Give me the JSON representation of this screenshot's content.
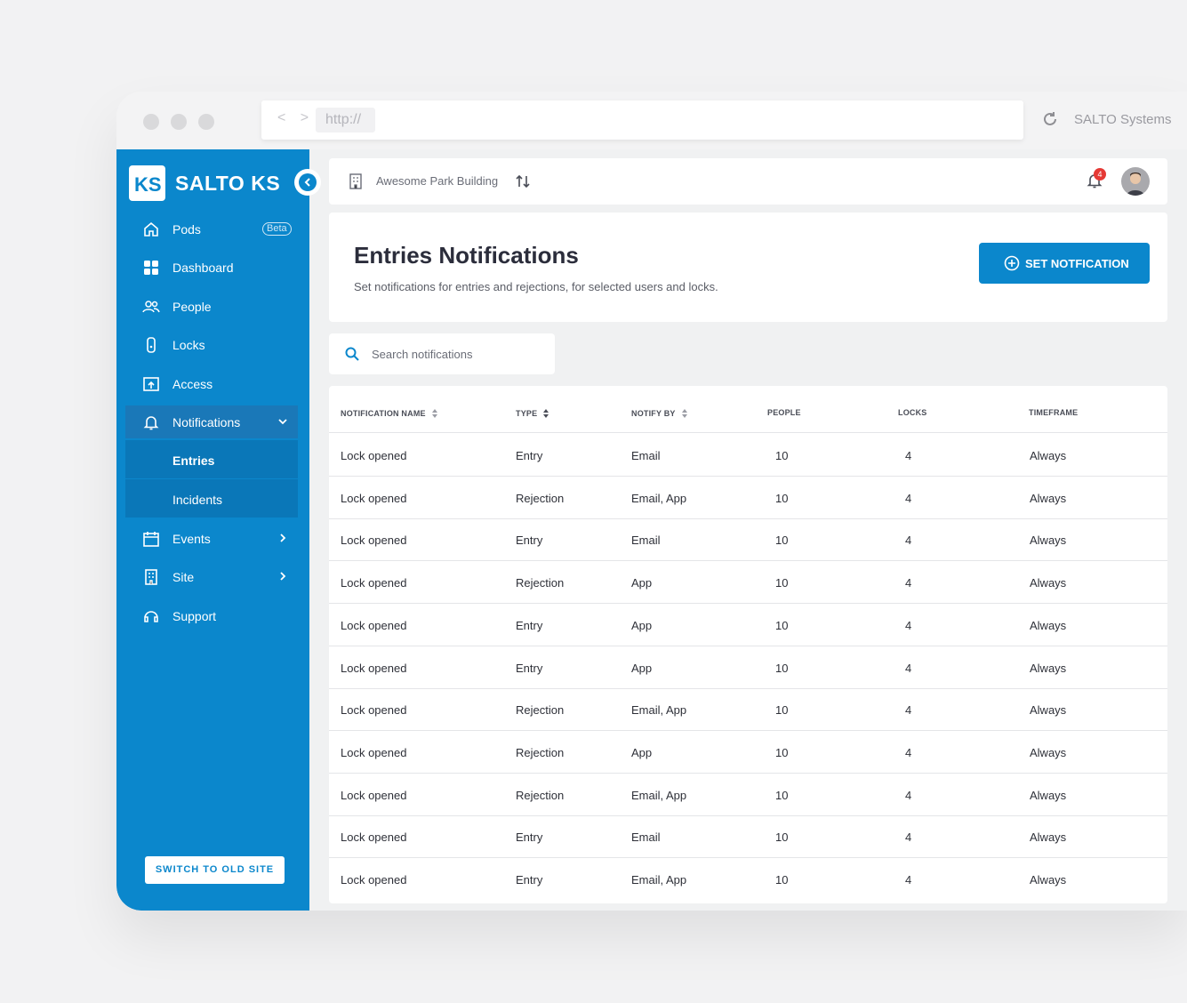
{
  "browser": {
    "url": "http://",
    "nav_arrows": "< >",
    "title": "SALTO Systems"
  },
  "sidebar": {
    "logo_text": "SALTO KS",
    "items": [
      {
        "label": "Pods",
        "icon": "home-icon",
        "badge": "Beta"
      },
      {
        "label": "Dashboard",
        "icon": "dashboard-icon"
      },
      {
        "label": "People",
        "icon": "people-icon"
      },
      {
        "label": "Locks",
        "icon": "lock-icon"
      },
      {
        "label": "Access",
        "icon": "access-icon"
      },
      {
        "label": "Notifications",
        "icon": "bell-icon",
        "expanded": true
      },
      {
        "label": "Events",
        "icon": "calendar-icon"
      },
      {
        "label": "Site",
        "icon": "building-icon"
      },
      {
        "label": "Support",
        "icon": "support-icon"
      }
    ],
    "subitems": [
      {
        "label": "Entries",
        "active": true
      },
      {
        "label": "Incidents",
        "active": false
      }
    ],
    "switch_label": "SWITCH TO OLD SITE"
  },
  "topbar": {
    "building": "Awesome Park Building",
    "notification_count": "4"
  },
  "header": {
    "title": "Entries Notifications",
    "subtitle": "Set notifications for entries and rejections, for selected users and locks.",
    "button_label": "SET NOTFICATION"
  },
  "search": {
    "placeholder": "Search notifications"
  },
  "table": {
    "columns": [
      "NOTIFICATION NAME",
      "TYPE",
      "NOTIFY BY",
      "PEOPLE",
      "LOCKS",
      "TIMEFRAME"
    ],
    "rows": [
      [
        "Lock opened",
        "Entry",
        "Email",
        "10",
        "4",
        "Always"
      ],
      [
        "Lock opened",
        "Rejection",
        "Email, App",
        "10",
        "4",
        "Always"
      ],
      [
        "Lock opened",
        "Entry",
        "Email",
        "10",
        "4",
        "Always"
      ],
      [
        "Lock opened",
        "Rejection",
        "App",
        "10",
        "4",
        "Always"
      ],
      [
        "Lock opened",
        "Entry",
        "App",
        "10",
        "4",
        "Always"
      ],
      [
        "Lock opened",
        "Entry",
        "App",
        "10",
        "4",
        "Always"
      ],
      [
        "Lock opened",
        "Rejection",
        "Email, App",
        "10",
        "4",
        "Always"
      ],
      [
        "Lock opened",
        "Rejection",
        "App",
        "10",
        "4",
        "Always"
      ],
      [
        "Lock opened",
        "Rejection",
        "Email, App",
        "10",
        "4",
        "Always"
      ],
      [
        "Lock opened",
        "Entry",
        "Email",
        "10",
        "4",
        "Always"
      ],
      [
        "Lock opened",
        "Entry",
        "Email, App",
        "10",
        "4",
        "Always"
      ]
    ]
  },
  "colors": {
    "brand": "#0b87cc",
    "badge": "#e53935"
  }
}
